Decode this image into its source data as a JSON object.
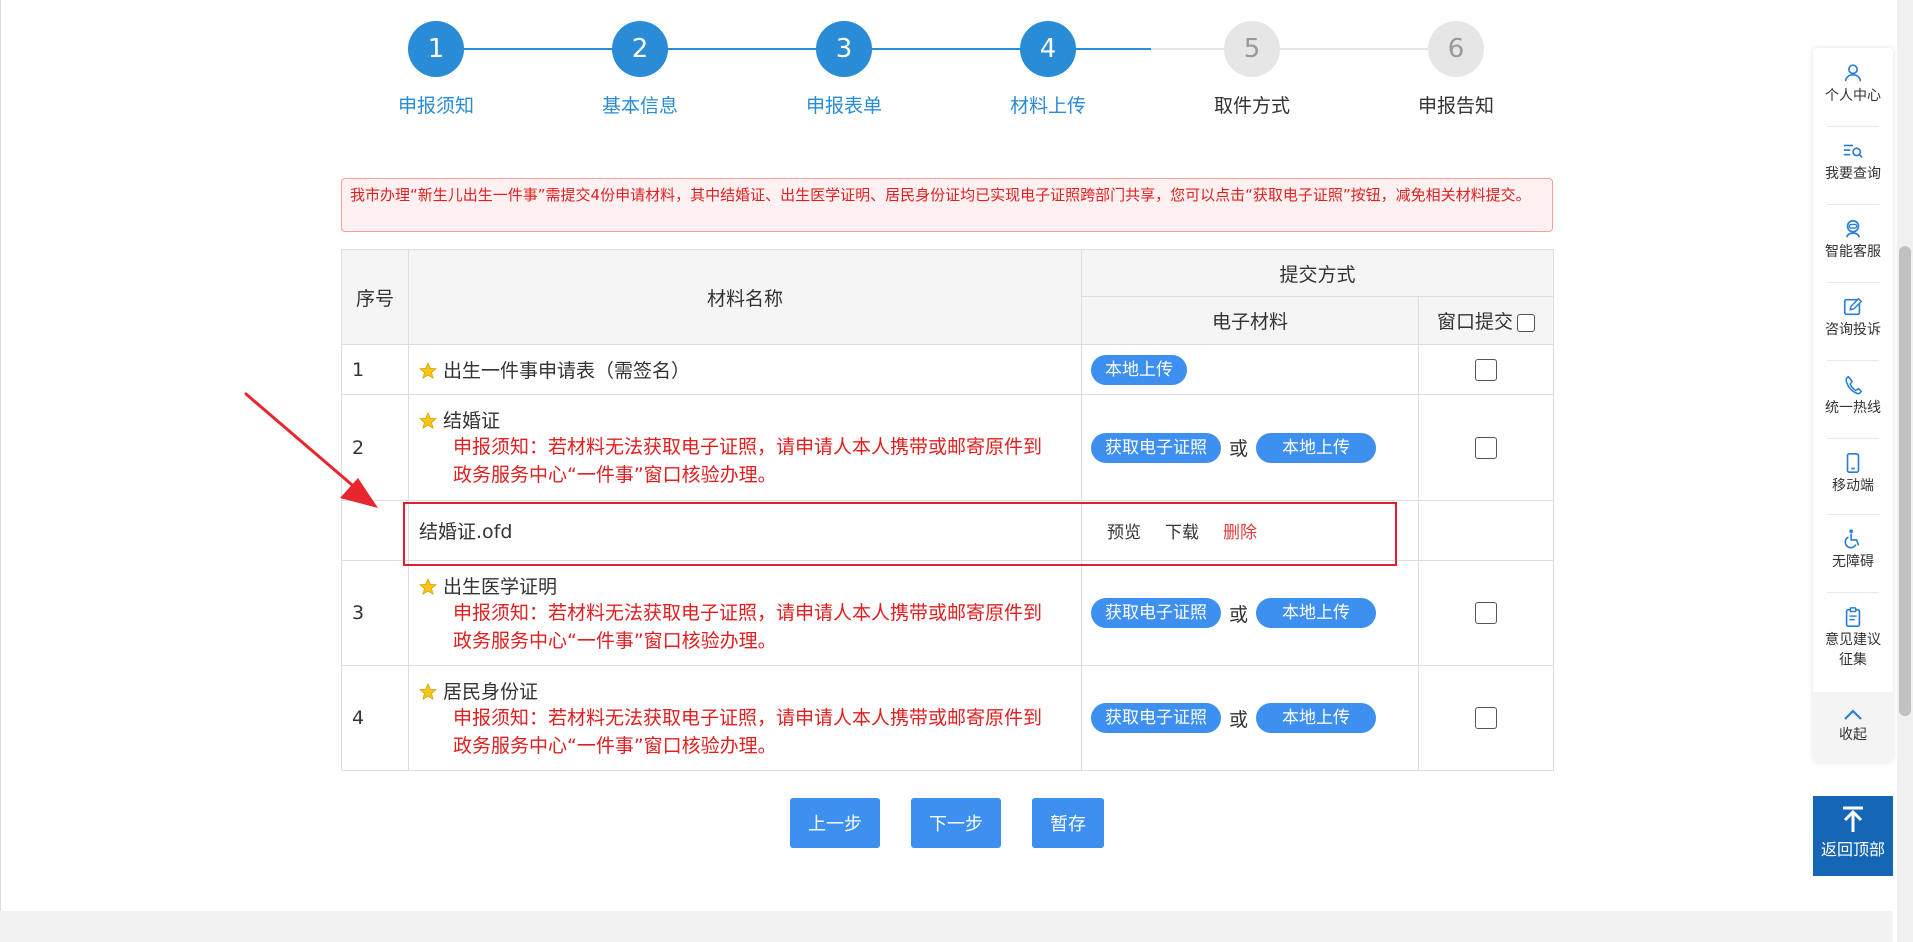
{
  "steps": [
    {
      "num": "1",
      "label": "申报须知",
      "state": "done"
    },
    {
      "num": "2",
      "label": "基本信息",
      "state": "done"
    },
    {
      "num": "3",
      "label": "申报表单",
      "state": "done"
    },
    {
      "num": "4",
      "label": "材料上传",
      "state": "done"
    },
    {
      "num": "5",
      "label": "取件方式",
      "state": "todo"
    },
    {
      "num": "6",
      "label": "申报告知",
      "state": "todo"
    }
  ],
  "notice": "我市办理“新生儿出生一件事”需提交4份申请材料，其中结婚证、出生医学证明、居民身份证均已实现电子证照跨部门共享，您可以点击“获取电子证照”按钮，减免相关材料提交。",
  "table": {
    "headers": {
      "seq": "序号",
      "name": "材料名称",
      "submit_method": "提交方式",
      "electronic": "电子材料",
      "window": "窗口提交"
    },
    "rows": [
      {
        "seq": "1",
        "name": "出生一件事申请表（需签名）",
        "upload": "本地上传"
      },
      {
        "seq": "2",
        "name": "结婚证",
        "warn1": "申报须知：若材料无法获取电子证照，请申请人本人携带或邮寄原件到",
        "warn2": "政务服务中心“一件事”窗口核验办理。",
        "fetch": "获取电子证照",
        "or": "或",
        "upload": "本地上传"
      },
      {
        "seq": "3",
        "name": "出生医学证明",
        "warn1": "申报须知：若材料无法获取电子证照，请申请人本人携带或邮寄原件到",
        "warn2": "政务服务中心“一件事”窗口核验办理。",
        "fetch": "获取电子证照",
        "or": "或",
        "upload": "本地上传"
      },
      {
        "seq": "4",
        "name": "居民身份证",
        "warn1": "申报须知：若材料无法获取电子证照，请申请人本人携带或邮寄原件到",
        "warn2": "政务服务中心“一件事”窗口核验办理。",
        "fetch": "获取电子证照",
        "or": "或",
        "upload": "本地上传"
      }
    ],
    "file": {
      "name": "结婚证.ofd",
      "preview": "预览",
      "download": "下载",
      "delete": "删除"
    }
  },
  "nav": {
    "prev": "上一步",
    "next": "下一步",
    "save": "暂存"
  },
  "sidebar": {
    "items": [
      {
        "label": "个人中心",
        "icon": "user-icon"
      },
      {
        "label": "我要查询",
        "icon": "search-list-icon"
      },
      {
        "label": "智能客服",
        "icon": "robot-icon"
      },
      {
        "label": "咨询投诉",
        "icon": "edit-icon"
      },
      {
        "label": "统一热线",
        "icon": "phone-icon"
      },
      {
        "label": "移动端",
        "icon": "mobile-icon"
      },
      {
        "label": "无障碍",
        "icon": "accessibility-icon"
      },
      {
        "label": "意见建议征集",
        "icon": "clipboard-icon"
      }
    ],
    "collapse": "收起",
    "back_top": "返回顶部"
  },
  "colors": {
    "primary": "#2a8bd6",
    "button": "#3d8ff0",
    "warning": "#e02020",
    "back_top": "#1566b5"
  }
}
